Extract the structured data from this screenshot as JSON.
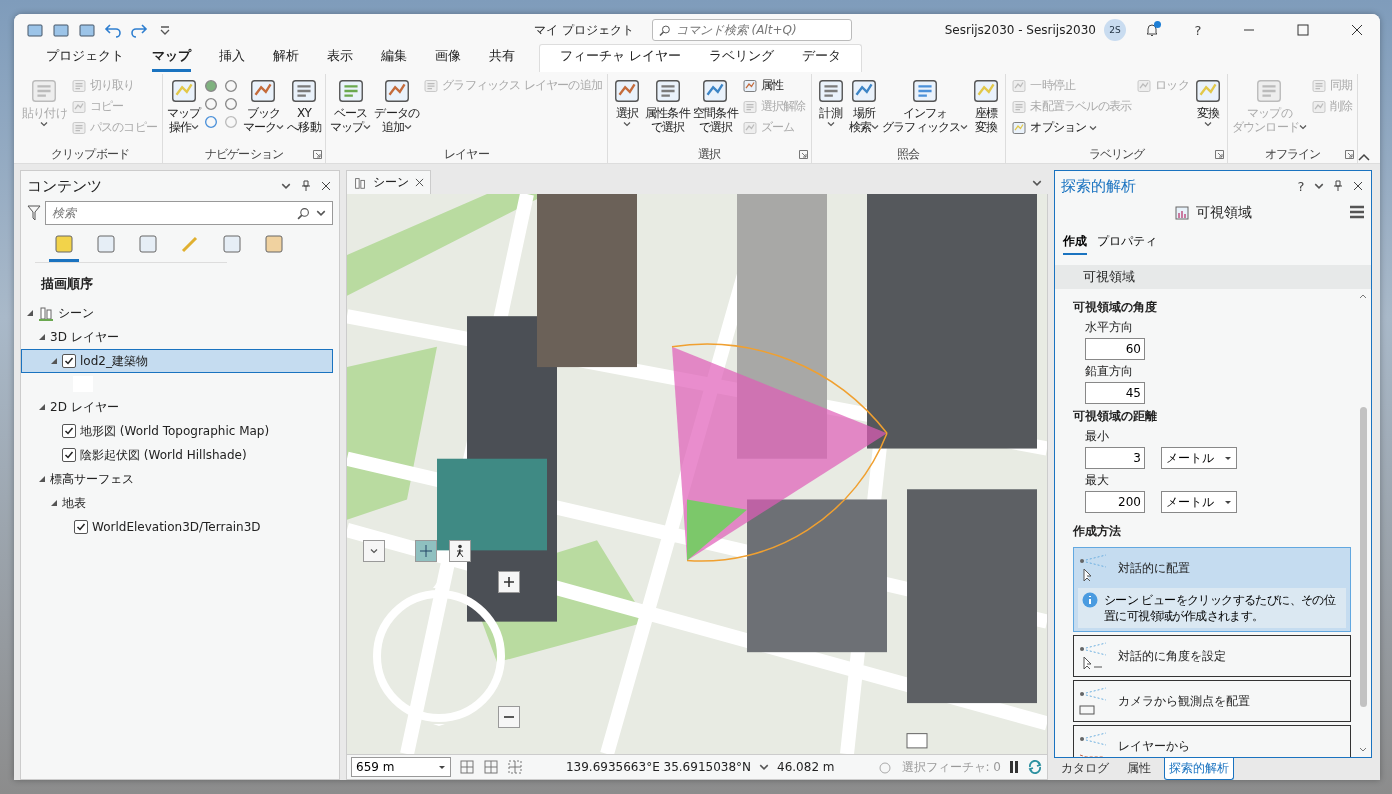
{
  "window": {
    "title": "マイ プロジェクト",
    "search_placeholder": "コマンド検索 (Alt+Q)",
    "account": "Sesrijs2030 - Sesrijs2030",
    "avatar": "2S",
    "notification": true,
    "help": "?"
  },
  "tabs": [
    {
      "label": "プロジェクト",
      "selected": false
    },
    {
      "label": "マップ",
      "selected": true
    },
    {
      "label": "挿入",
      "selected": false
    },
    {
      "label": "解析",
      "selected": false
    },
    {
      "label": "表示",
      "selected": false
    },
    {
      "label": "編集",
      "selected": false
    },
    {
      "label": "画像",
      "selected": false
    },
    {
      "label": "共有",
      "selected": false
    }
  ],
  "contextual_tabs": [
    {
      "label": "フィーチャ レイヤー",
      "selected": false
    },
    {
      "label": "ラベリング",
      "selected": false
    },
    {
      "label": "データ",
      "selected": false
    }
  ],
  "ribbon": {
    "groups": [
      {
        "label": "クリップボード",
        "launcher": false,
        "items": [
          {
            "kind": "large",
            "lines": [
              "貼り付け"
            ],
            "disabled": true,
            "dropdown": true
          },
          {
            "kind": "stack",
            "items": [
              {
                "label": "切り取り",
                "disabled": true
              },
              {
                "label": "コピー",
                "disabled": true
              },
              {
                "label": "パスのコピー",
                "disabled": true
              }
            ]
          }
        ]
      },
      {
        "label": "ナビゲーション",
        "launcher": true,
        "items": [
          {
            "kind": "large",
            "lines": [
              "マップ",
              "操作"
            ],
            "disabled": false,
            "dropdown": true
          },
          {
            "kind": "icon-grid"
          },
          {
            "kind": "large",
            "lines": [
              "ブック",
              "マーク"
            ],
            "disabled": false,
            "dropdown": true
          },
          {
            "kind": "large",
            "lines": [
              "XY",
              "へ移動"
            ],
            "disabled": false,
            "dropdown": false
          }
        ]
      },
      {
        "label": "レイヤー",
        "launcher": false,
        "items": [
          {
            "kind": "large",
            "lines": [
              "ベース",
              "マップ"
            ],
            "disabled": false,
            "dropdown": true
          },
          {
            "kind": "large",
            "lines": [
              "データの",
              "追加"
            ],
            "disabled": false,
            "dropdown": true
          },
          {
            "kind": "stack",
            "items": [
              {
                "label": "グラフィックス レイヤーの追加",
                "disabled": true
              }
            ]
          }
        ]
      },
      {
        "label": "選択",
        "launcher": true,
        "items": [
          {
            "kind": "large",
            "lines": [
              "選択"
            ],
            "disabled": false,
            "dropdown": true
          },
          {
            "kind": "large",
            "lines": [
              "属性条件",
              "で選択"
            ],
            "disabled": false,
            "dropdown": false
          },
          {
            "kind": "large",
            "lines": [
              "空間条件",
              "で選択"
            ],
            "disabled": false,
            "dropdown": false
          },
          {
            "kind": "stack",
            "items": [
              {
                "label": "属性",
                "disabled": false
              },
              {
                "label": "選択解除",
                "disabled": true
              },
              {
                "label": "ズーム",
                "disabled": true
              }
            ]
          }
        ]
      },
      {
        "label": "照会",
        "launcher": false,
        "items": [
          {
            "kind": "large",
            "lines": [
              "計測"
            ],
            "disabled": false,
            "dropdown": true
          },
          {
            "kind": "large",
            "lines": [
              "場所",
              "検索"
            ],
            "disabled": false,
            "dropdown": true
          },
          {
            "kind": "large",
            "lines": [
              "インフォ",
              "グラフィックス"
            ],
            "disabled": false,
            "dropdown": true
          },
          {
            "kind": "large",
            "lines": [
              "座標",
              "変換"
            ],
            "disabled": false,
            "dropdown": false
          }
        ]
      },
      {
        "label": "ラベリング",
        "launcher": true,
        "items": [
          {
            "kind": "stack",
            "items": [
              {
                "label": "一時停止",
                "disabled": true
              },
              {
                "label": "未配置ラベルの表示",
                "disabled": true
              },
              {
                "label": "オプション",
                "disabled": false,
                "dropdown": true
              }
            ]
          },
          {
            "kind": "stack",
            "items": [
              {
                "label": "ロック",
                "disabled": true
              }
            ]
          },
          {
            "kind": "large",
            "lines": [
              "変換"
            ],
            "disabled": false,
            "dropdown": true
          }
        ]
      },
      {
        "label": "オフライン",
        "launcher": true,
        "items": [
          {
            "kind": "large",
            "lines": [
              "マップの",
              "ダウンロード"
            ],
            "disabled": true,
            "dropdown": true
          },
          {
            "kind": "stack",
            "items": [
              {
                "label": "同期",
                "disabled": true
              },
              {
                "label": "削除",
                "disabled": true
              }
            ]
          }
        ]
      }
    ]
  },
  "contents": {
    "title": "コンテンツ",
    "search_placeholder": "検索",
    "views": [
      {
        "selected": true
      },
      {
        "selected": false
      },
      {
        "selected": false
      },
      {
        "selected": false
      },
      {
        "selected": false
      },
      {
        "selected": false
      }
    ],
    "heading": "描画順序",
    "tree": [
      {
        "label": "シーン",
        "expanded": true,
        "children": [
          {
            "label": "3D レイヤー",
            "expanded": true,
            "children": [
              {
                "label": "lod2_建築物",
                "checked": true,
                "selected": true,
                "expanded": true
              }
            ]
          },
          {
            "label": "2D レイヤー",
            "expanded": true,
            "children": [
              {
                "label": "地形図 (World Topographic Map)",
                "checked": true,
                "selected": false
              },
              {
                "label": "陰影起伏図 (World Hillshade)",
                "checked": true,
                "selected": false
              }
            ]
          },
          {
            "label": "標高サーフェス",
            "expanded": true,
            "children": [
              {
                "label": "地表",
                "expanded": true,
                "children": [
                  {
                    "label": "WorldElevation3D/Terrain3D",
                    "checked": true,
                    "selected": false
                  }
                ]
              }
            ]
          }
        ]
      }
    ]
  },
  "scene": {
    "tab": "シーン",
    "scale": "659 m",
    "coordinates": "139.6935663°E 35.6915038°N",
    "elevation": "46.082 m",
    "selected_features": "選択フィーチャ: 0"
  },
  "analysis": {
    "title": "探索的解析",
    "help": "?",
    "tool": "可視領域",
    "tabs": [
      {
        "label": "作成",
        "selected": true
      },
      {
        "label": "プロパティ",
        "selected": false
      }
    ],
    "section": "可視領域",
    "groups": [
      {
        "label": "可視領域の角度",
        "fields": [
          {
            "label": "水平方向",
            "value": "60"
          },
          {
            "label": "鉛直方向",
            "value": "45"
          }
        ]
      },
      {
        "label": "可視領域の距離",
        "fields": [
          {
            "label": "最小",
            "value": "3",
            "unit": "メートル"
          },
          {
            "label": "最大",
            "value": "200",
            "unit": "メートル"
          }
        ]
      }
    ],
    "methods_label": "作成方法",
    "methods": [
      {
        "kind": "place",
        "label": "対話的に配置",
        "selected": true,
        "info": "シーン ビューをクリックするたびに、その位置に可視領域が作成されます。"
      },
      {
        "kind": "angle",
        "label": "対話的に角度を設定",
        "selected": false
      },
      {
        "kind": "camera",
        "label": "カメラから観測点を配置",
        "selected": false
      },
      {
        "kind": "layer",
        "label": "レイヤーから",
        "selected": false
      }
    ]
  },
  "dock_tabs": [
    {
      "label": "カタログ",
      "selected": false
    },
    {
      "label": "属性",
      "selected": false
    },
    {
      "label": "探索的解析",
      "selected": true
    }
  ]
}
